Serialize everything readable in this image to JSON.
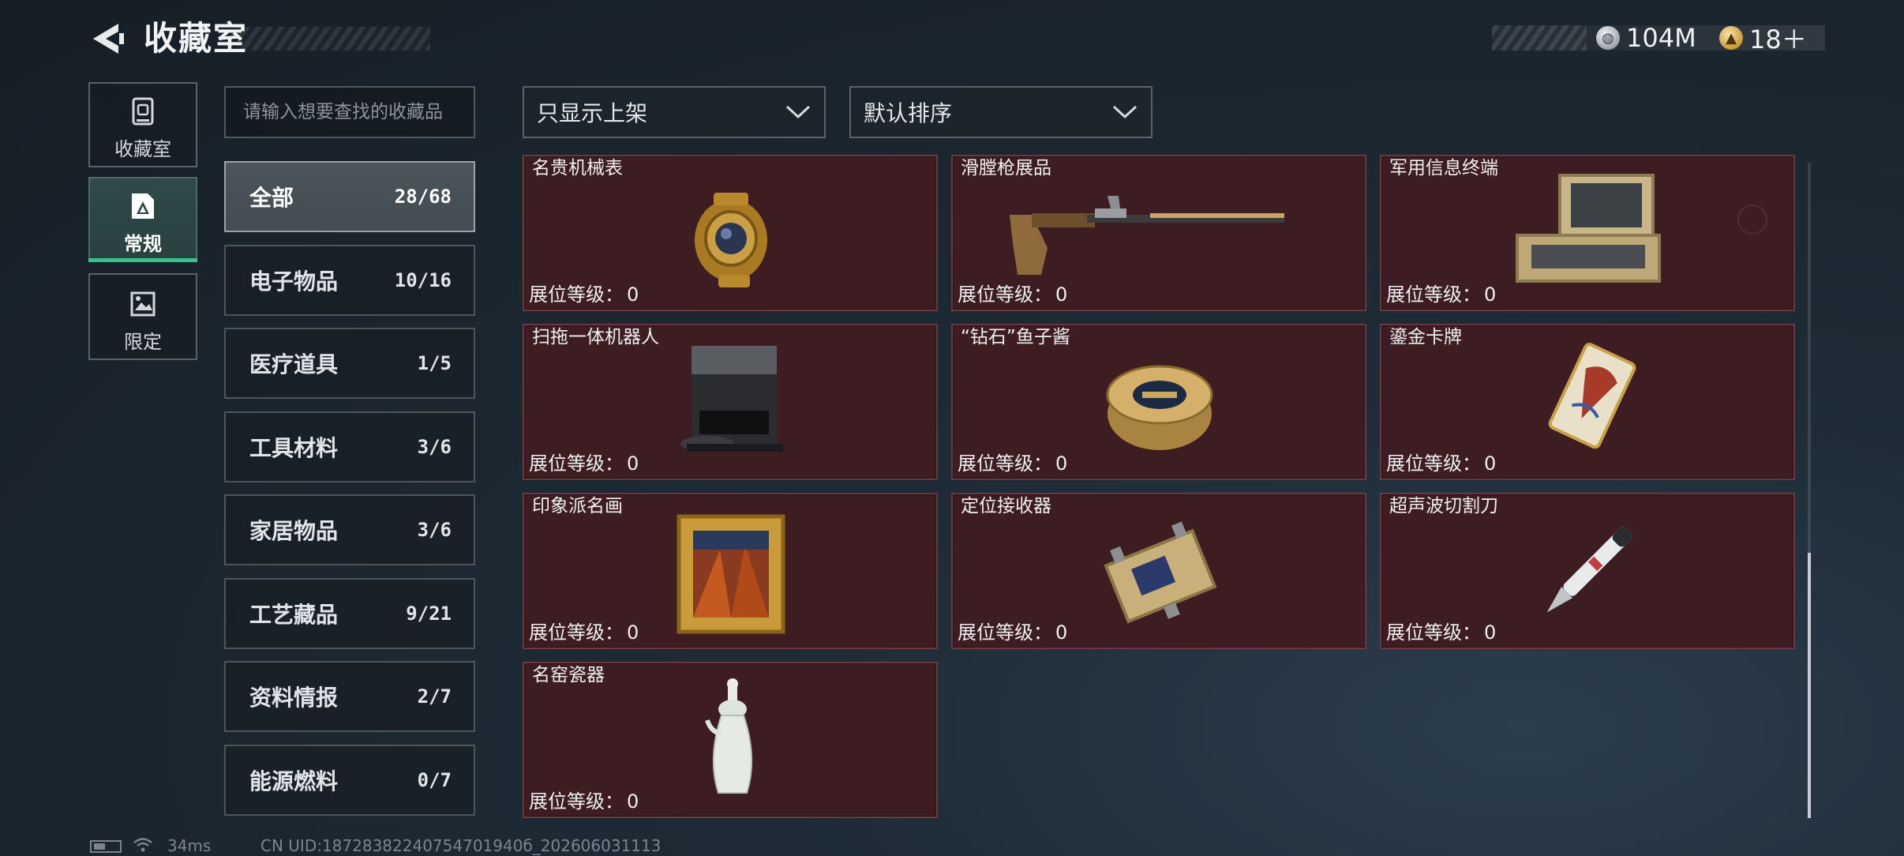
{
  "header": {
    "title": "收藏室",
    "back_icon": "back-arrow-icon"
  },
  "currency": [
    {
      "icon": "silver-coin-icon",
      "value": "104M"
    },
    {
      "icon": "gold-coin-icon",
      "value": "18＋"
    }
  ],
  "rail": [
    {
      "label": "收藏室",
      "icon": "trash-bin-icon",
      "active": false
    },
    {
      "label": "常规",
      "icon": "document-a-icon",
      "active": true
    },
    {
      "label": "限定",
      "icon": "picture-icon",
      "active": false
    }
  ],
  "search": {
    "placeholder": "请输入想要查找的收藏品",
    "value": ""
  },
  "filters": {
    "shelf": {
      "value": "只显示上架"
    },
    "sort": {
      "value": "默认排序"
    }
  },
  "categories": [
    {
      "name": "全部",
      "count": "28/68",
      "active": true
    },
    {
      "name": "电子物品",
      "count": "10/16"
    },
    {
      "name": "医疗道具",
      "count": "1/5"
    },
    {
      "name": "工具材料",
      "count": "3/6"
    },
    {
      "name": "家居物品",
      "count": "3/6"
    },
    {
      "name": "工艺藏品",
      "count": "9/21"
    },
    {
      "name": "资料情报",
      "count": "2/7"
    },
    {
      "name": "能源燃料",
      "count": "0/7"
    }
  ],
  "items": [
    {
      "name": "名贵机械表",
      "level_label": "展位等级：",
      "level": "0",
      "icon": "watch-icon"
    },
    {
      "name": "滑膛枪展品",
      "level_label": "展位等级：",
      "level": "0",
      "icon": "musket-icon"
    },
    {
      "name": "军用信息终端",
      "level_label": "展位等级：",
      "level": "0",
      "icon": "terminal-case-icon"
    },
    {
      "name": "扫拖一体机器人",
      "level_label": "展位等级：",
      "level": "0",
      "icon": "robot-vacuum-icon"
    },
    {
      "name": "“钻石”鱼子酱",
      "level_label": "展位等级：",
      "level": "0",
      "icon": "caviar-tin-icon"
    },
    {
      "name": "鎏金卡牌",
      "level_label": "展位等级：",
      "level": "0",
      "icon": "gilded-card-icon"
    },
    {
      "name": "印象派名画",
      "level_label": "展位等级：",
      "level": "0",
      "icon": "framed-painting-icon"
    },
    {
      "name": "定位接收器",
      "level_label": "展位等级：",
      "level": "0",
      "icon": "gps-receiver-icon"
    },
    {
      "name": "超声波切割刀",
      "level_label": "展位等级：",
      "level": "0",
      "icon": "ultrasonic-knife-icon"
    },
    {
      "name": "名窑瓷器",
      "level_label": "展位等级：",
      "level": "0",
      "icon": "porcelain-vase-icon"
    }
  ],
  "status_bar": {
    "ping": "34ms",
    "uid": "CN UID:18728382240754701940б_202606031113"
  }
}
